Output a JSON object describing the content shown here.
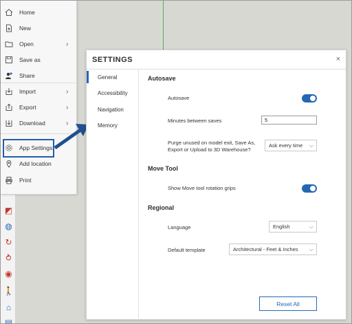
{
  "menu": {
    "items": [
      {
        "label": "Home",
        "icon": "home-icon",
        "submenu": false
      },
      {
        "label": "New",
        "icon": "new-file-icon",
        "submenu": false
      },
      {
        "label": "Open",
        "icon": "folder-icon",
        "submenu": true
      },
      {
        "label": "Save as",
        "icon": "save-icon",
        "submenu": false
      },
      {
        "label": "Share",
        "icon": "share-user-icon",
        "submenu": false
      },
      {
        "label": "Import",
        "icon": "import-icon",
        "submenu": true
      },
      {
        "label": "Export",
        "icon": "export-icon",
        "submenu": true
      },
      {
        "label": "Download",
        "icon": "download-icon",
        "submenu": true
      },
      {
        "label": "App Settings",
        "icon": "gear-icon",
        "submenu": false
      },
      {
        "label": "Add location",
        "icon": "location-pin-icon",
        "submenu": false
      },
      {
        "label": "Print",
        "icon": "printer-icon",
        "submenu": false
      }
    ],
    "highlighted": "App Settings"
  },
  "settings": {
    "title": "SETTINGS",
    "close": "×",
    "nav": [
      {
        "label": "General",
        "active": true
      },
      {
        "label": "Accessibility",
        "active": false
      },
      {
        "label": "Navigation",
        "active": false
      },
      {
        "label": "Memory",
        "active": false
      }
    ],
    "autosave": {
      "heading": "Autosave",
      "toggle_label": "Autosave",
      "toggle_on": true,
      "minutes_label": "Minutes between saves",
      "minutes_value": "5",
      "purge_label_1": "Purge unused on model exit, Save As,",
      "purge_label_2": "Export or Upload to 3D Warehouse?",
      "purge_value": "Ask every time"
    },
    "move_tool": {
      "heading": "Move Tool",
      "grips_label": "Show Move tool rotation grips",
      "grips_on": true
    },
    "regional": {
      "heading": "Regional",
      "language_label": "Language",
      "language_value": "English",
      "template_label": "Default template",
      "template_value": "Architectural - Feet & Inches"
    },
    "reset_label": "Reset All"
  },
  "colors": {
    "accent": "#2468b3",
    "highlight_box": "#1f5fa8"
  }
}
